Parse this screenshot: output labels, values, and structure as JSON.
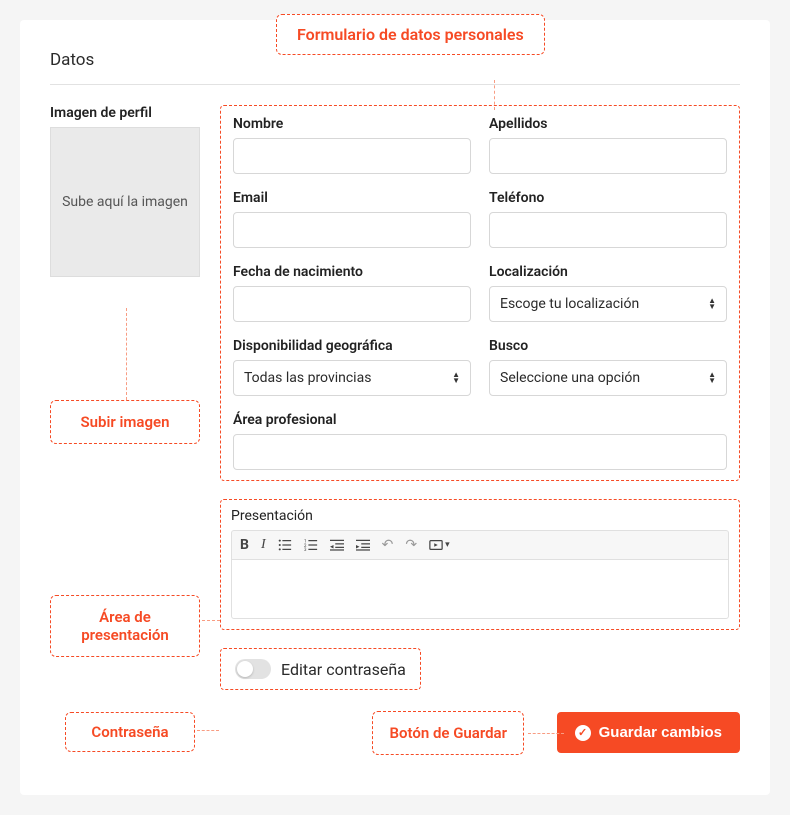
{
  "header": {
    "title": "Datos"
  },
  "callouts": {
    "form": "Formulario de datos personales",
    "upload": "Subir imagen",
    "presentation": "Área de presentación",
    "password": "Contraseña",
    "save": "Botón de Guardar"
  },
  "profile": {
    "label": "Imagen de perfil",
    "drop_text": "Sube aquí la imagen"
  },
  "fields": {
    "nombre": {
      "label": "Nombre",
      "value": ""
    },
    "apellidos": {
      "label": "Apellidos",
      "value": ""
    },
    "email": {
      "label": "Email",
      "value": ""
    },
    "telefono": {
      "label": "Teléfono",
      "value": ""
    },
    "fecha_nacimiento": {
      "label": "Fecha de nacimiento",
      "value": ""
    },
    "localizacion": {
      "label": "Localización",
      "placeholder": "Escoge tu localización"
    },
    "disponibilidad": {
      "label": "Disponibilidad geográfica",
      "placeholder": "Todas las provincias"
    },
    "busco": {
      "label": "Busco",
      "placeholder": "Seleccione una opción"
    },
    "area_profesional": {
      "label": "Área profesional",
      "value": ""
    }
  },
  "presentation": {
    "label": "Presentación"
  },
  "password": {
    "label": "Editar contraseña"
  },
  "actions": {
    "save": "Guardar cambios"
  }
}
